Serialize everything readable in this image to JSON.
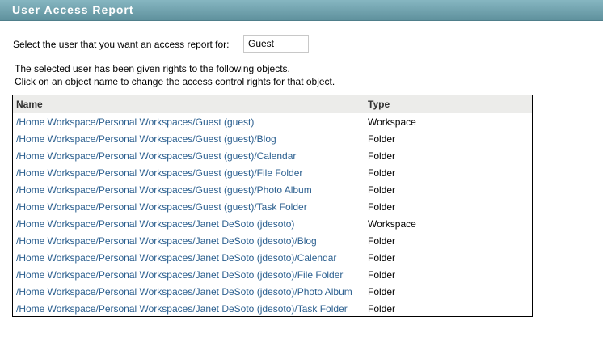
{
  "header": {
    "title": "User Access Report"
  },
  "selector": {
    "label": "Select the user that you want an access report for:",
    "value": "Guest"
  },
  "info": {
    "line1": "The selected user has been given rights to the following objects.",
    "line2": "Click on an object name to change the access control rights for that object."
  },
  "table": {
    "columns": [
      "Name",
      "Type"
    ],
    "rows": [
      {
        "name": "/Home Workspace/Personal Workspaces/Guest (guest)",
        "type": "Workspace"
      },
      {
        "name": "/Home Workspace/Personal Workspaces/Guest (guest)/Blog",
        "type": "Folder"
      },
      {
        "name": "/Home Workspace/Personal Workspaces/Guest (guest)/Calendar",
        "type": "Folder"
      },
      {
        "name": "/Home Workspace/Personal Workspaces/Guest (guest)/File Folder",
        "type": "Folder"
      },
      {
        "name": "/Home Workspace/Personal Workspaces/Guest (guest)/Photo Album",
        "type": "Folder"
      },
      {
        "name": "/Home Workspace/Personal Workspaces/Guest (guest)/Task Folder",
        "type": "Folder"
      },
      {
        "name": "/Home Workspace/Personal Workspaces/Janet DeSoto (jdesoto)",
        "type": "Workspace"
      },
      {
        "name": "/Home Workspace/Personal Workspaces/Janet DeSoto (jdesoto)/Blog",
        "type": "Folder"
      },
      {
        "name": "/Home Workspace/Personal Workspaces/Janet DeSoto (jdesoto)/Calendar",
        "type": "Folder"
      },
      {
        "name": "/Home Workspace/Personal Workspaces/Janet DeSoto (jdesoto)/File Folder",
        "type": "Folder"
      },
      {
        "name": "/Home Workspace/Personal Workspaces/Janet DeSoto (jdesoto)/Photo Album",
        "type": "Folder"
      },
      {
        "name": "/Home Workspace/Personal Workspaces/Janet DeSoto (jdesoto)/Task Folder",
        "type": "Folder"
      }
    ]
  }
}
